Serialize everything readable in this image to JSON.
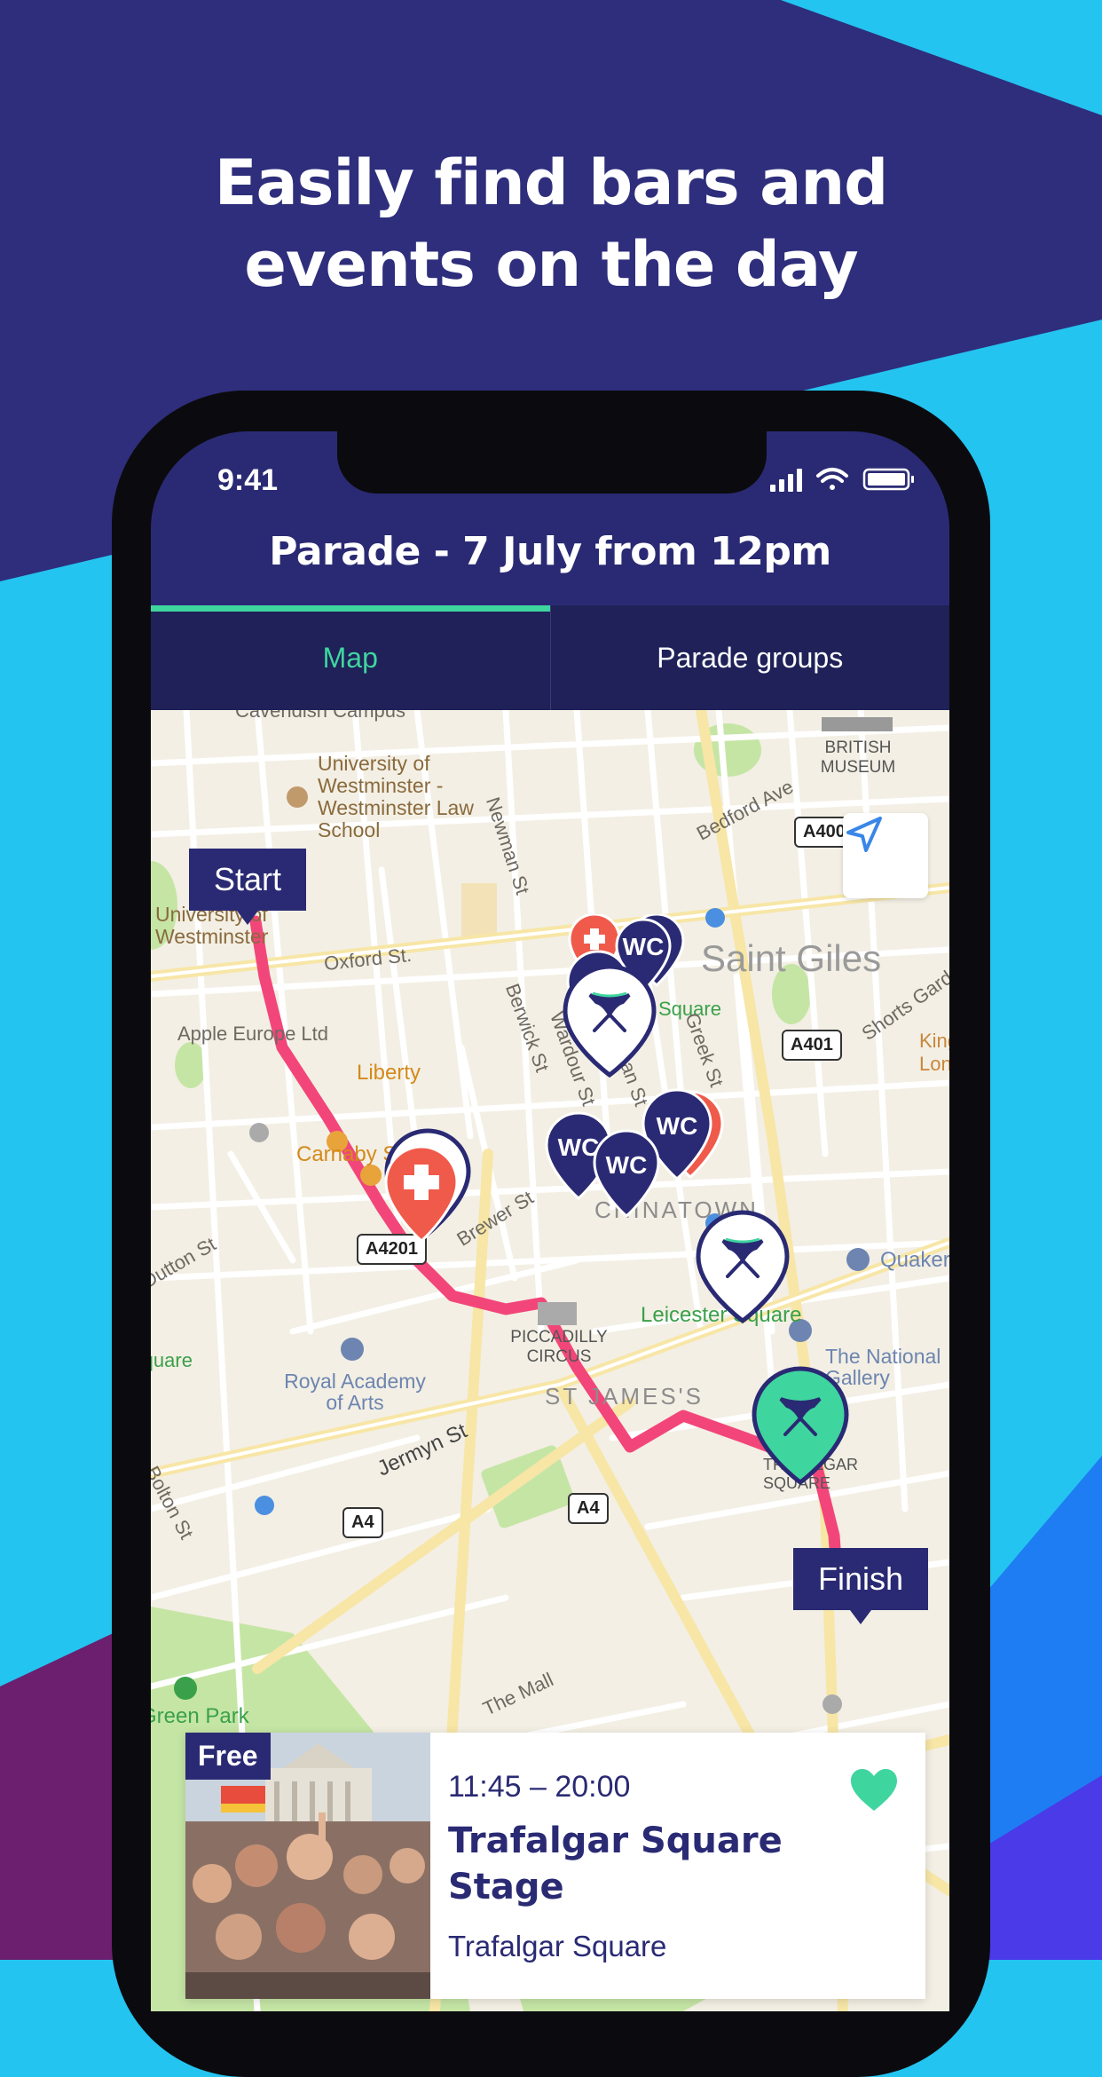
{
  "headline": {
    "line1": "Easily find bars and",
    "line2": "events on the day"
  },
  "colors": {
    "navy": "#2a2a74",
    "cyan": "#24c4f0",
    "accent_green": "#3fd59f",
    "route_pink": "#f2467a",
    "first_aid_red": "#f05a4a"
  },
  "status_bar": {
    "time": "9:41",
    "icons": [
      "signal-icon",
      "wifi-icon",
      "battery-icon"
    ]
  },
  "nav": {
    "title": "Parade - 7 July from 12pm"
  },
  "tabs": [
    {
      "label": "Map",
      "active": true
    },
    {
      "label": "Parade groups",
      "active": false
    }
  ],
  "map": {
    "start_label": "Start",
    "finish_label": "Finish",
    "labels": {
      "cavendish": "Cavendish Campus",
      "uow_law": "University of Westminster - Westminster Law School",
      "uow": "University of Westminster",
      "british_museum": "BRITISH MUSEUM",
      "bedford_ave": "Bedford Ave",
      "newman_st": "Newman St",
      "oxford_st": "Oxford St.",
      "saint_giles": "Saint Giles",
      "square": "Square",
      "apple": "Apple Europe Ltd",
      "liberty": "Liberty",
      "carnaby": "Carnaby St",
      "berwick_st": "Berwick St",
      "wardour_st": "Wardour St",
      "dean_st": "Dean St",
      "greek_st": "Greek St",
      "shorts_gardens": "Shorts Gardens",
      "kings_london": "King's London",
      "chinatown": "CHINATOWN",
      "brewer_st": "Brewer St",
      "quaker": "Quaker",
      "leicester_square": "Leicester Square",
      "piccadilly": "PICCADILLY CIRCUS",
      "the_national_gallery": "The National Gallery",
      "royal_academy": "Royal Academy of Arts",
      "st_jamess": "ST JAMES'S",
      "jermyn_st": "Jermyn St",
      "trafalgar": "TRAFALGAR SQUARE",
      "bolton_st": "Bolton St",
      "dutton_st": "Dutton St",
      "square_left": "Square",
      "green_park": "Green Park",
      "the_mall": "The Mall"
    },
    "road_shields": {
      "a400": "A400",
      "a401": "A401",
      "a4201": "A4201",
      "a4_left": "A4",
      "a4_mid": "A4"
    },
    "pin_texts": {
      "wc": "WC"
    }
  },
  "event_card": {
    "badge": "Free",
    "time": "11:45 – 20:00",
    "title": "Trafalgar Square Stage",
    "venue": "Trafalgar Square",
    "favorited": true
  }
}
